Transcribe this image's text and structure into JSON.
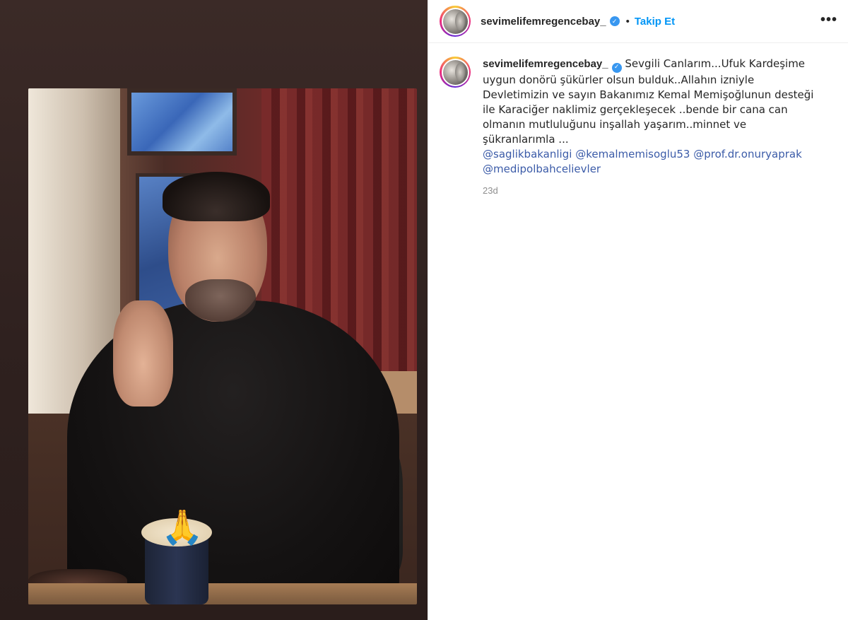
{
  "post": {
    "username": "sevimelifemregencebay_",
    "follow_label": "Takip Et",
    "separator": "•",
    "more_label": "•••",
    "verified_mark": "✓",
    "caption_text": " Sevgili Canlarım...Ufuk Kardeşime uygun donörü şükürler olsun bulduk..Allahın izniyle Devletimizin ve sayın Bakanımız Kemal Memişoğlunun desteği ile Karaciğer naklimiz gerçekleşecek ..bende bir cana can olmanın mutluluğunu inşallah yaşarım..minnet ve şükranlarımla ...",
    "mentions": [
      "@saglikbakanligi",
      "@kemalmemisoglu53",
      "@prof.dr.onuryaprak",
      "@medipolbahcelievler"
    ],
    "time_ago": "23d"
  },
  "photo": {
    "sticker_glyph": "🙏"
  },
  "colors": {
    "accent": "#0095f6",
    "verified": "#3897f0",
    "mention": "#3b5ba8",
    "meta": "#8e8e8e"
  },
  "icons": [
    "verified-badge-icon",
    "more-options-icon",
    "prayer-hands-icon"
  ]
}
